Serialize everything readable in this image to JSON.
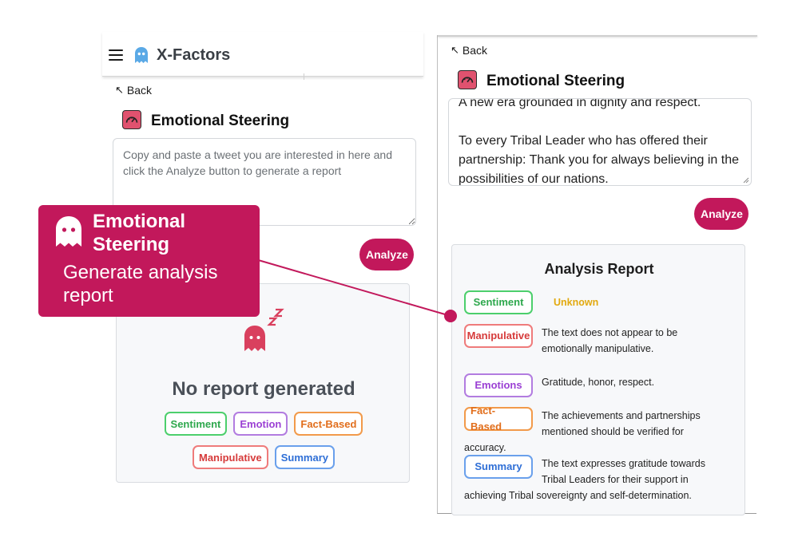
{
  "left": {
    "app_title": "X-Factors",
    "back_label": "Back",
    "feature_title": "Emotional Steering",
    "input_placeholder": "Copy and paste a tweet you are interested in here and click the Analyze button to generate a report",
    "analyze_label": "Analyze",
    "empty_title": "No report generated",
    "empty_tags": [
      "Sentiment",
      "Emotion",
      "Fact-Based",
      "Manipulative",
      "Summary"
    ]
  },
  "right": {
    "back_label": "Back",
    "feature_title": "Emotional Steering",
    "tweet_text": "A new era grounded in dignity and respect.\n\nTo every Tribal Leader who has offered their partnership: Thank you for always believing in the possibilities of our nations.",
    "analyze_label": "Analyze",
    "report": {
      "title": "Analysis Report",
      "sentiment_label": "Sentiment",
      "sentiment_value": "Unknown",
      "manipulative_label": "Manipulative",
      "manipulative_text": "The text does not appear to be emotionally manipulative.",
      "emotions_label": "Emotions",
      "emotions_text": "Gratitude, honor, respect.",
      "factbased_label": "Fact-Based",
      "factbased_text": "The achievements and partnerships mentioned should be verified for accuracy.",
      "summary_label": "Summary",
      "summary_text": "The text expresses gratitude towards Tribal Leaders for their support in achieving Tribal sovereignty and self-determination."
    }
  },
  "callout": {
    "title": "Emotional Steering",
    "subtitle": "Generate analysis report"
  },
  "colors": {
    "brand": "#c2185b",
    "sentiment": "#2ea84d",
    "emotion": "#9b40d4",
    "fact_based": "#e16e1c",
    "manipulative": "#d63b3b",
    "summary": "#2f6fd6",
    "unknown": "#e2a90e"
  },
  "icons": {
    "menu": "menu-icon",
    "logo": "ghost-icon",
    "feature": "speedometer-icon",
    "back": "arrow-up-left-icon",
    "empty": "sleeping-ghost-icon"
  }
}
